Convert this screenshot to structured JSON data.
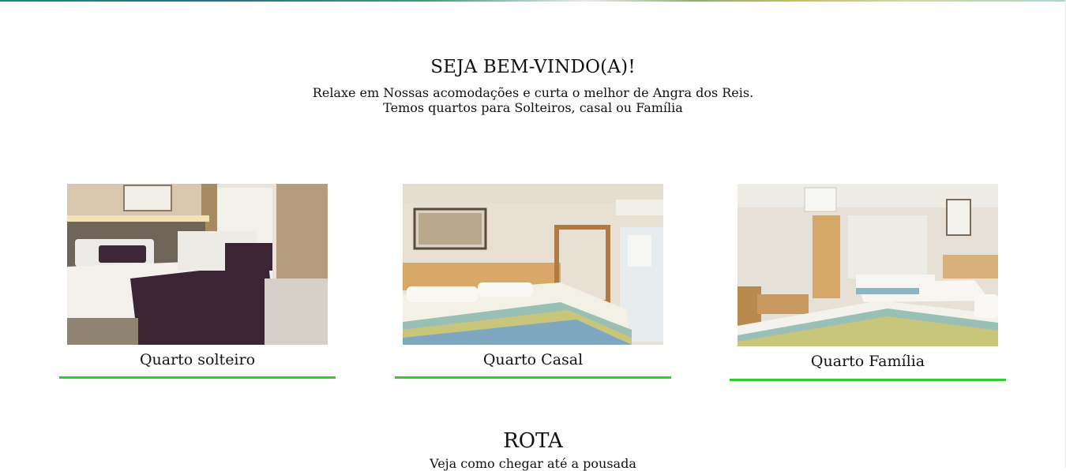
{
  "welcome": {
    "title": "SEJA BEM-VINDO(A)!",
    "line1": "Relaxe em Nossas acomodações e curta o melhor de Angra dos Reis.",
    "line2": "Temos quartos para Solteiros, casal ou Família"
  },
  "rooms": [
    {
      "label": "Quarto solteiro"
    },
    {
      "label": "Quarto Casal"
    },
    {
      "label": "Quarto Família"
    }
  ],
  "rota": {
    "title": "ROTA",
    "subtitle": "Veja como chegar até a pousada"
  },
  "colors": {
    "accent_underline": "#2ecc2e",
    "background": "#ffffff"
  }
}
